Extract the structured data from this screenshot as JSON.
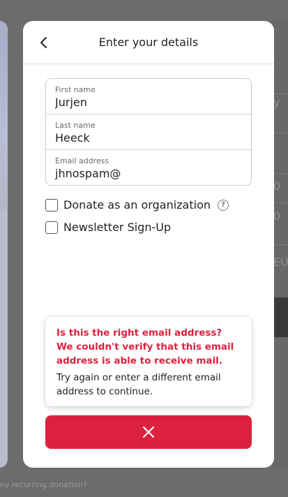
{
  "modal": {
    "title": "Enter your details",
    "fields": [
      {
        "label": "First name",
        "value": "Jurjen"
      },
      {
        "label": "Last name",
        "value": "Heeck"
      },
      {
        "label": "Email address",
        "value": "jhnospam@"
      }
    ],
    "checkboxes": [
      {
        "label": "Donate as an organization",
        "checked": false
      },
      {
        "label": "Newsletter Sign-Up",
        "checked": false
      }
    ],
    "help_icon_text": "?",
    "alert": {
      "error": "Is this the right email address? We couldn't verify that this email address is able to receive mail.",
      "info": "Try again or enter a different email address to continue."
    },
    "close_button": {
      "icon": "close-icon"
    },
    "accent_color": "#dc213f"
  },
  "background": {
    "right_rows": [
      "y",
      "0",
      "0",
      "EUR"
    ],
    "bottom_text": "ny recurring donation?"
  }
}
